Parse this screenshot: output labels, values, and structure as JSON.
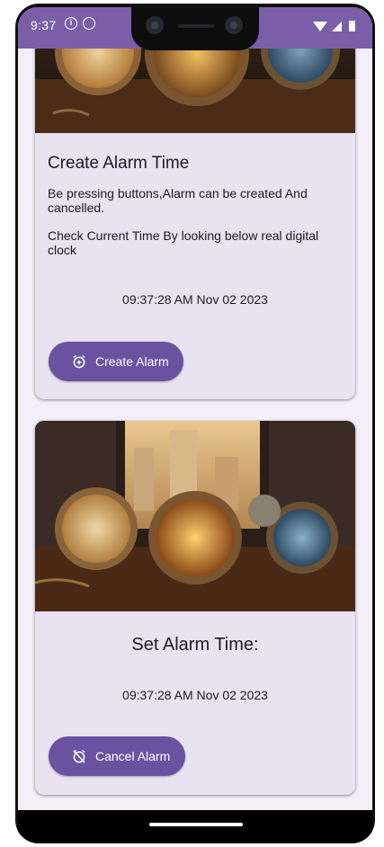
{
  "status_bar": {
    "time": "9:37",
    "icons_left": [
      "info-icon",
      "sync-icon"
    ],
    "icons_right": [
      "wifi-icon",
      "signal-icon",
      "battery-icon"
    ]
  },
  "cards": [
    {
      "image": "alarm-clocks-photo",
      "title": "Create Alarm Time",
      "text_1": "Be pressing buttons,Alarm can be created And cancelled.",
      "text_2": "Check Current Time By looking below real digital clock",
      "clock": "09:37:28 AM Nov 02 2023",
      "button_label": "Create Alarm",
      "button_icon": "alarm-add-icon"
    },
    {
      "image": "alarm-clocks-photo",
      "title": "Set Alarm Time:",
      "clock": "09:37:28 AM Nov 02 2023",
      "button_label": "Cancel Alarm",
      "button_icon": "alarm-off-icon"
    }
  ],
  "colors": {
    "status_bar": "#7a5fa8",
    "card_background": "#e9e2f1",
    "button": "#6a52a0"
  }
}
